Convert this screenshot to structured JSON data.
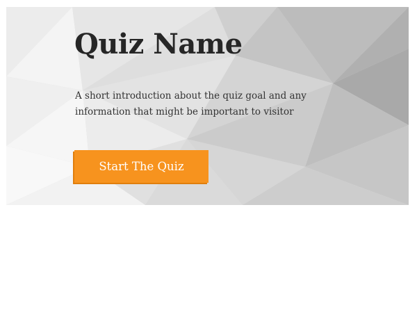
{
  "quiz": {
    "title": "Quiz Name",
    "introduction": "A short introduction about the quiz goal and any information that might be important to visitor",
    "start_button_label": "Start The Quiz"
  },
  "colors": {
    "accent": "#f7931e",
    "title_text": "#262626",
    "body_text": "#333333",
    "background_pattern": "#dcdcdc"
  }
}
